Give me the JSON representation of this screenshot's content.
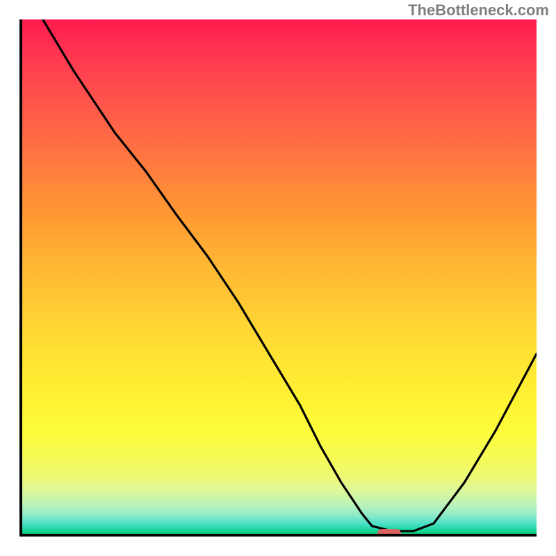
{
  "watermark": "TheBottleneck.com",
  "chart_data": {
    "type": "line",
    "title": "",
    "xlabel": "",
    "ylabel": "",
    "xlim": [
      0,
      100
    ],
    "ylim": [
      0,
      100
    ],
    "grid": false,
    "series": [
      {
        "name": "curve",
        "x": [
          4,
          10,
          18,
          24,
          30,
          36,
          42,
          48,
          54,
          58,
          62,
          66,
          68,
          72,
          76,
          80,
          86,
          92,
          100
        ],
        "y": [
          100,
          90,
          78,
          70.5,
          62,
          54,
          45,
          35,
          25,
          17,
          10,
          4,
          1.5,
          0.5,
          0.5,
          2,
          10,
          20,
          35
        ]
      }
    ],
    "marker": {
      "x": 71,
      "y": 0.5,
      "color": "#d9645f"
    },
    "background_gradient": {
      "top": "#ff1a4d",
      "mid": "#ffd133",
      "bottom": "#0bd07e"
    }
  }
}
